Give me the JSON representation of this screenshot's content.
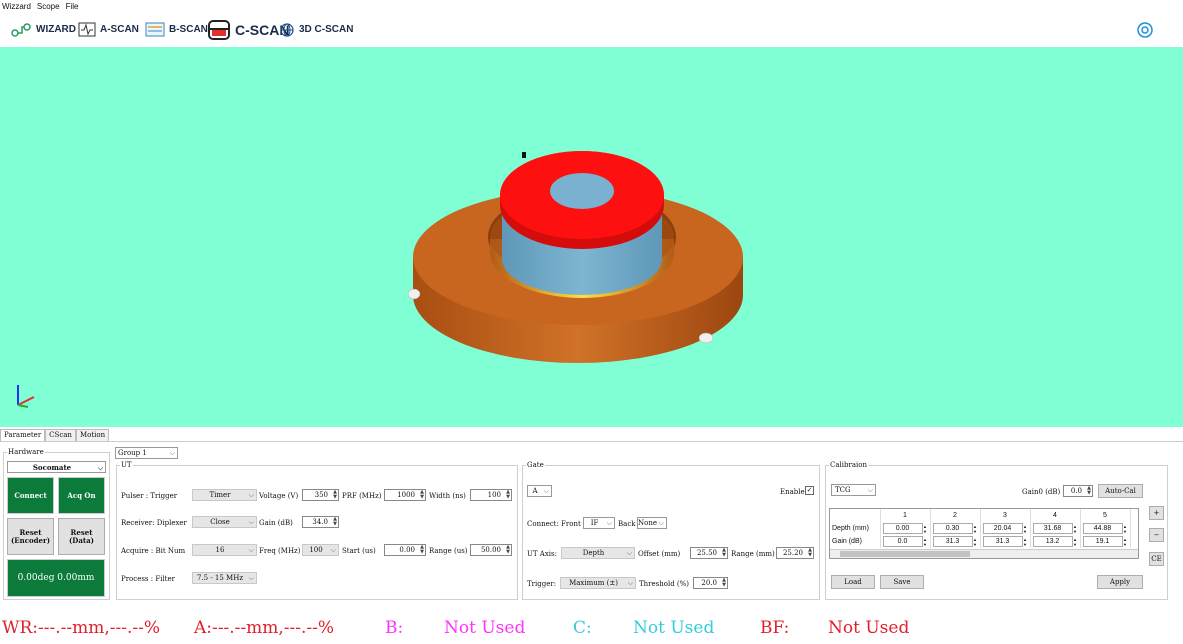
{
  "menu": [
    "Wizzard",
    "Scope",
    "File"
  ],
  "toolbar": {
    "wizard": "WIZARD",
    "ascan": "A-SCAN",
    "bscan": "B-SCAN",
    "cscan": "C-SCAN",
    "cscan3d": "3D C-SCAN"
  },
  "colors": {
    "viewport_bg": "#80ffd4",
    "part_copper": "#c8651f",
    "top_ring": "#ff1010",
    "inner_ring": "#6fa8c4",
    "green_button": "#0b7a3a",
    "status_red": "#e0202a",
    "status_magenta": "#ff33ff",
    "status_cyan": "#33ccdd"
  },
  "tabs": [
    "Parameter",
    "CScan",
    "Motion"
  ],
  "hardware": {
    "legend": "Hardware",
    "device": "Socomate",
    "connect": "Connect",
    "acq_on": "Acq On",
    "reset_encoder": "Reset\n(Encoder)",
    "reset_data": "Reset\n(Data)",
    "position": "0.00deg 0.00mm"
  },
  "group": "Group 1",
  "ut": {
    "legend": "UT",
    "pulser_label": "Pulser  : Trigger",
    "trigger": "Timer",
    "voltage_label": "Voltage (V)",
    "voltage": "350",
    "prf_label": "PRF  (MHz)",
    "prf": "1000",
    "width_label": "Width (ns)",
    "width": "100",
    "receiver_label": "Receiver: Diplexer",
    "diplexer": "Close",
    "gain_label": "Gain   (dB)",
    "gain": "34.0",
    "acquire_label": "Acquire : Bit Num",
    "bitnum": "16",
    "freq_label": "Freq  (MHz)",
    "freq": "100",
    "start_label": "Start (us)",
    "start": "0.00",
    "range_label": "Range (us)",
    "range": "50.00",
    "process_label": "Process : Filter",
    "filter": "7.5 - 15 MHz"
  },
  "gate": {
    "legend": "Gate",
    "gate_sel": "A",
    "enable_label": "Enable",
    "connect_label": "Connect: Front",
    "front": "IF",
    "back_label": "Back",
    "back": "None",
    "ut_axis_label": "UT Axis:",
    "ut_axis": "Depth",
    "offset_label": "Offset   (mm)",
    "offset": "25.50",
    "range_label": "Range   (mm)",
    "range": "25.20",
    "trigger_label": "Trigger:",
    "trigger": "Maximum   (±)",
    "threshold_label": "Threshold (%)",
    "threshold": "20.0"
  },
  "calibration": {
    "legend": "Calibraion",
    "mode": "TCG",
    "gain0_label": "Gain0 (dB)",
    "gain0": "0.0",
    "autocal": "Auto-Cal",
    "columns": [
      "1",
      "2",
      "3",
      "4",
      "5"
    ],
    "depth_label": "Depth (mm)",
    "depth": [
      "0.00",
      "0.30",
      "20.04",
      "31.68",
      "44.88"
    ],
    "gain_label": "Gain (dB)",
    "gain": [
      "0.0",
      "31.3",
      "31.3",
      "13.2",
      "19.1"
    ],
    "load": "Load",
    "save": "Save",
    "apply": "Apply",
    "plus": "+",
    "minus": "−",
    "clear": "CE"
  },
  "status": {
    "wr": "WR:---.--mm,---.--%",
    "a": "A:---.--mm,---.--%",
    "b_label": "B:",
    "b_value": "Not Used",
    "c_label": "C:",
    "c_value": "Not Used",
    "bf_label": "BF:",
    "bf_value": "Not Used"
  }
}
